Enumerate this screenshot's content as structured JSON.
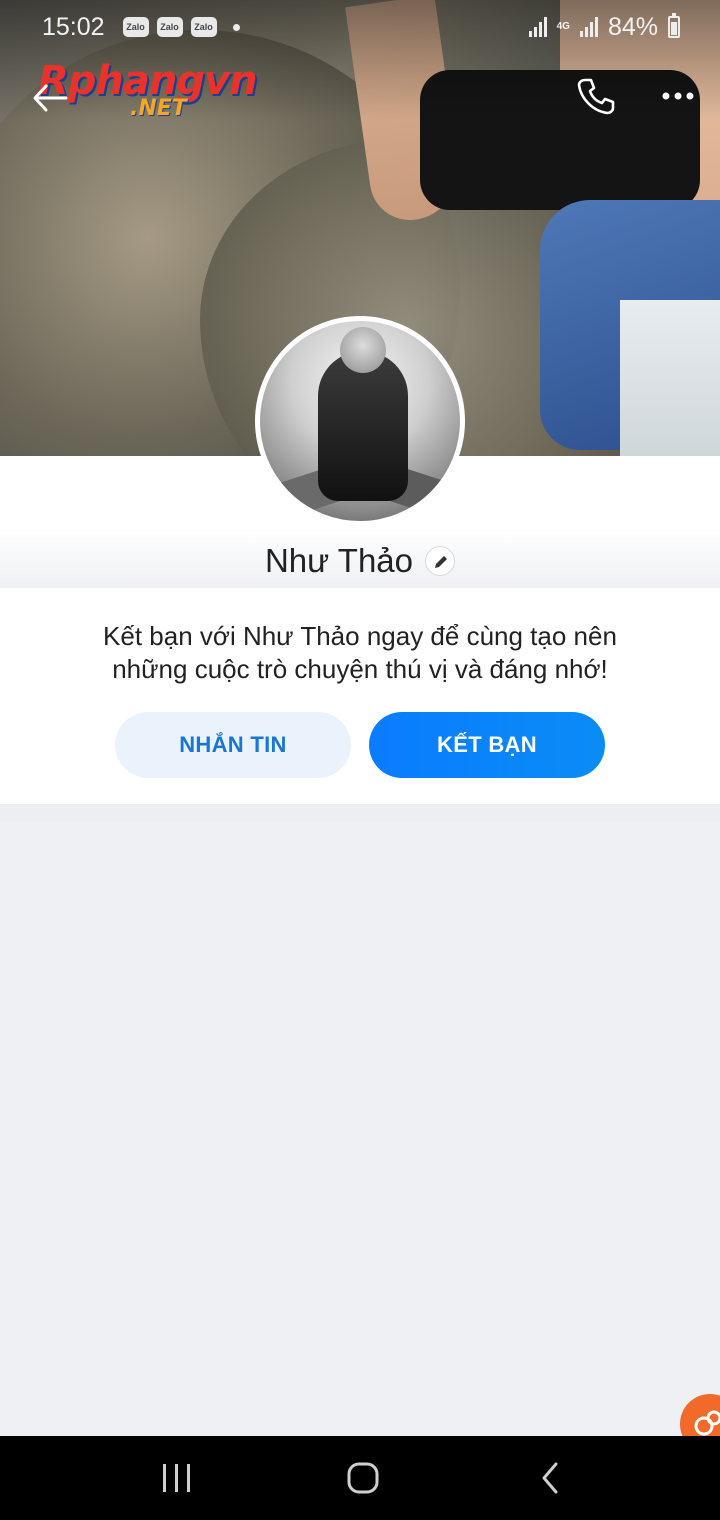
{
  "status_bar": {
    "time": "15:02",
    "notification_apps": [
      "Zalo",
      "Zalo",
      "Zalo"
    ],
    "network_type": "4G",
    "battery_percent": "84%"
  },
  "header": {
    "watermark_main": "Rphangvn",
    "watermark_sub": ".NET",
    "icons": [
      "back-arrow-icon",
      "phone-icon",
      "more-icon"
    ]
  },
  "profile": {
    "name": "Như Thảo"
  },
  "invite": {
    "message_line1": "Kết bạn với Như Thảo ngay để cùng tạo nên",
    "message_line2": "những cuộc trò chuyện thú vị và đáng nhớ!",
    "message_button": "NHẮN TIN",
    "add_friend_button": "KẾT BẠN"
  },
  "colors": {
    "primary": "#0a7cff",
    "secondary_button_bg": "#eaf3fb",
    "secondary_button_text": "#1976d2",
    "float_button": "#f26a2a",
    "page_bg": "#eff0f4"
  },
  "nav_bar": {
    "icons": [
      "recent-apps-icon",
      "home-icon",
      "nav-back-icon"
    ]
  }
}
